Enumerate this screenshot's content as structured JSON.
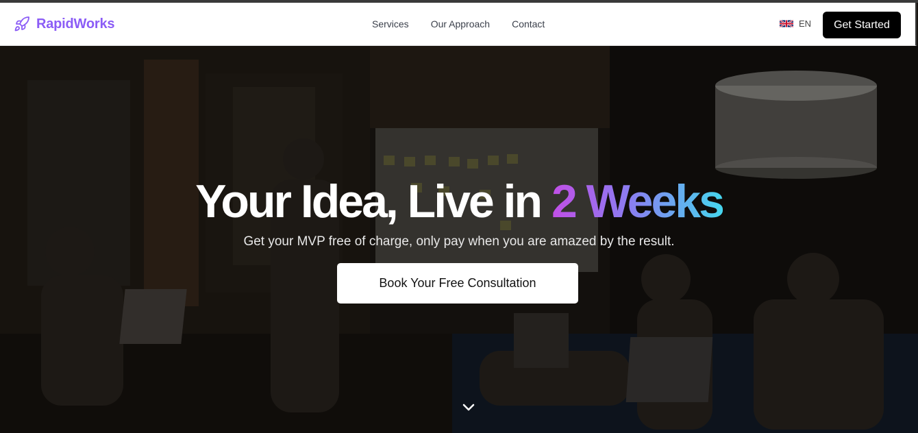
{
  "brand": {
    "name": "RapidWorks",
    "color": "#8b5cf6",
    "icon": "rocket-icon"
  },
  "nav": {
    "links": [
      {
        "label": "Services"
      },
      {
        "label": "Our Approach"
      },
      {
        "label": "Contact"
      }
    ],
    "language": {
      "code": "EN",
      "flag_icon": "uk-flag-icon"
    },
    "cta_label": "Get Started"
  },
  "hero": {
    "headline_main": "Your Idea, Live in ",
    "headline_highlight": "2 Weeks",
    "subtitle": "Get your MVP free of charge, only pay when you are amazed by the result.",
    "cta_label": "Book Your Free Consultation",
    "scroll_icon": "chevron-down-icon",
    "gradient_colors": [
      "#c14fe6",
      "#8b7cf0",
      "#46d6ee"
    ]
  }
}
